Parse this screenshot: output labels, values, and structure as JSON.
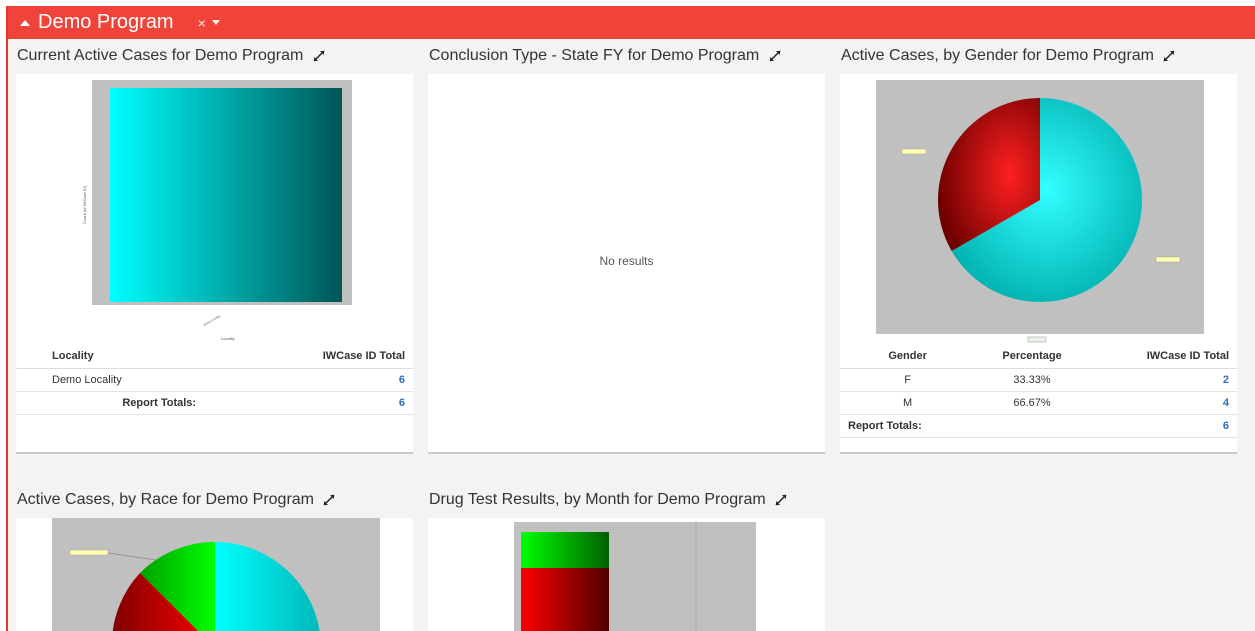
{
  "header": {
    "title": "Demo Program",
    "close_label": "×"
  },
  "widgets": {
    "active_cases": {
      "title": "Current Active Cases for Demo Program",
      "columns": [
        "Locality",
        "IWCase ID Total"
      ],
      "rows": [
        {
          "locality": "Demo Locality",
          "total": "6"
        }
      ],
      "totals_label": "Report Totals:",
      "totals_value": "6",
      "chart_data": {
        "type": "bar",
        "categories": [
          "Demo Locality"
        ],
        "values": [
          6
        ],
        "xlabel": "Locality",
        "ylabel": "Count (of IWCase ID)"
      }
    },
    "conclusion": {
      "title": "Conclusion Type - State FY for Demo Program",
      "empty": "No results"
    },
    "gender": {
      "title": "Active Cases, by Gender for Demo Program",
      "columns": [
        "Gender",
        "Percentage",
        "IWCase ID Total"
      ],
      "rows": [
        {
          "gender": "F",
          "pct": "33.33%",
          "total": "2"
        },
        {
          "gender": "M",
          "pct": "66.67%",
          "total": "4"
        }
      ],
      "totals_label": "Report Totals:",
      "totals_value": "6",
      "chart_data": {
        "type": "pie",
        "categories": [
          "F",
          "M"
        ],
        "values": [
          33.33,
          66.67
        ]
      }
    },
    "race": {
      "title": "Active Cases, by Race for Demo Program"
    },
    "drug": {
      "title": "Drug Test Results, by Month for Demo Program"
    }
  },
  "colors": {
    "brand": "#f0433a",
    "link": "#2a6ebb",
    "cyan": "#00e5e5",
    "red": "#e00000",
    "green": "#00d000"
  }
}
